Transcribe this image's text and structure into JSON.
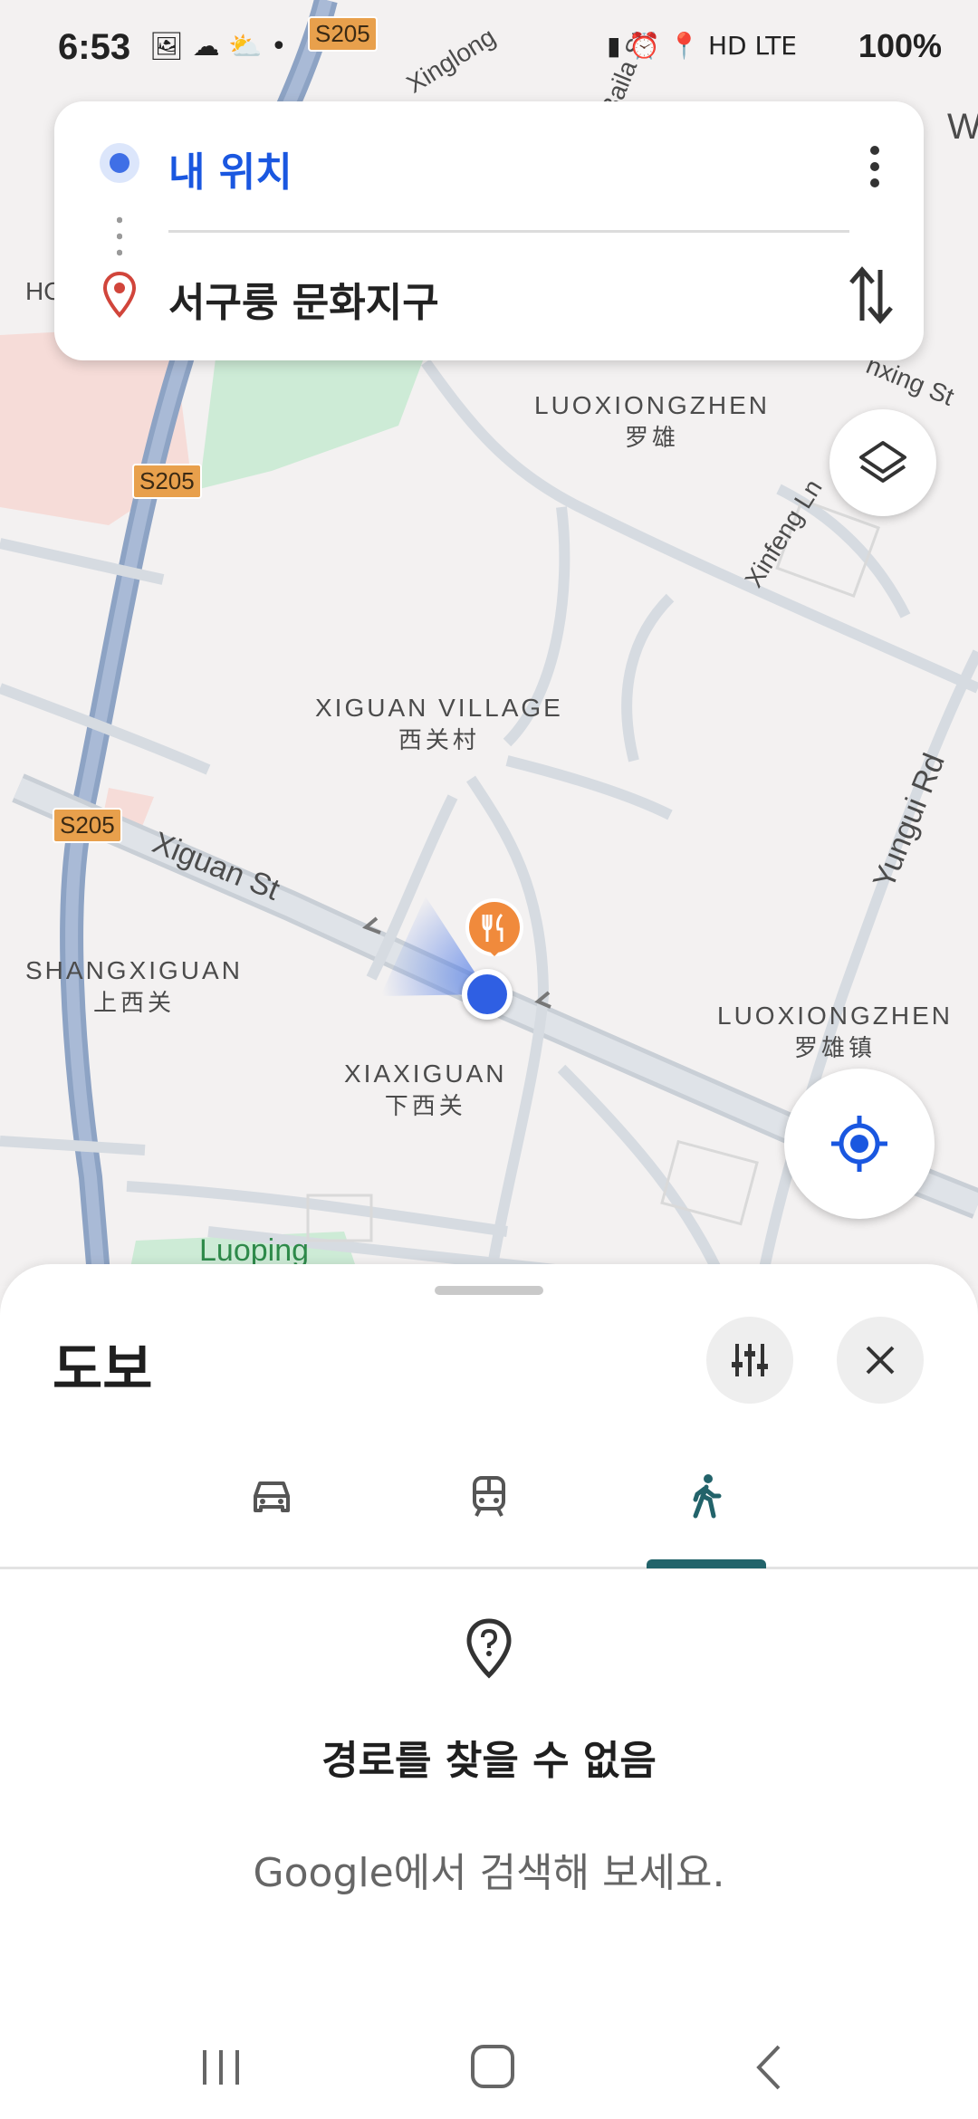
{
  "status_bar": {
    "time": "6:53",
    "left_icons": "🖼 ☁ ⛅ •",
    "right_icons": "▮ ⏰ 📍 HD LTE",
    "battery": "100%"
  },
  "search": {
    "origin": "내 위치",
    "destination": "서구룽 문화지구"
  },
  "map": {
    "route_badges": [
      "S205",
      "S205",
      "S205"
    ],
    "places": [
      {
        "en": "LUOXIONGZHEN",
        "zh": "罗雄"
      },
      {
        "en": "XIGUAN VILLAGE",
        "zh": "西关村"
      },
      {
        "en": "SHANGXIGUAN",
        "zh": "上西关"
      },
      {
        "en": "XIAXIGUAN",
        "zh": "下西关"
      },
      {
        "en": "LUOXIONGZHEN",
        "zh": "罗雄镇"
      }
    ],
    "streets": [
      "Xiguan St",
      "Yungui Rd",
      "Xinfeng Ln",
      "Xinglong",
      "Baila St",
      "Luoping",
      "HO",
      "nxing St",
      "W"
    ]
  },
  "sheet": {
    "title": "도보",
    "tabs": [
      "car-icon",
      "transit-icon",
      "walk-icon"
    ],
    "active_tab": 2,
    "empty_title": "경로를 찾을 수 없음",
    "empty_subtitle": "Google에서 검색해 보세요."
  },
  "colors": {
    "accent_blue": "#1a57e0",
    "active_tab": "#22636a",
    "route_badge": "#e8a04c",
    "restaurant": "#f08a3c"
  }
}
